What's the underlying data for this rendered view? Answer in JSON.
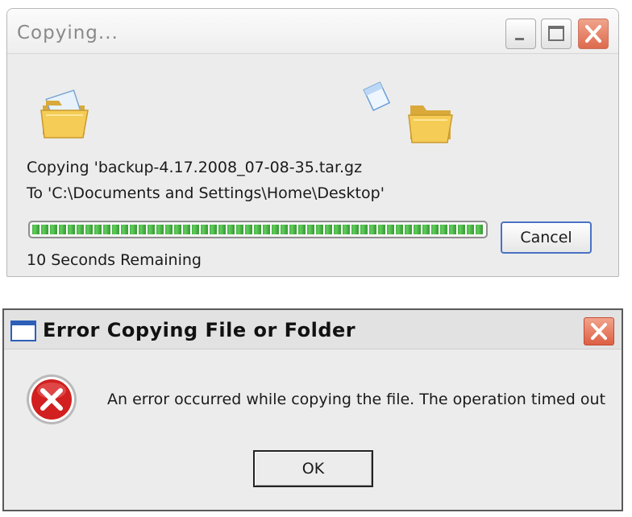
{
  "copy_dialog": {
    "title": "Copying...",
    "line1": "Copying 'backup-4.17.2008_07-08-35.tar.gz",
    "line2": "To 'C:\\Documents and Settings\\Home\\Desktop'",
    "progress_fraction": 1.0,
    "cancel_label": "Cancel",
    "remaining_text": "10 Seconds Remaining",
    "icons": {
      "source": "folder-with-document-icon",
      "flying": "document-icon",
      "destination": "folder-icon",
      "minimize": "minimize-icon",
      "maximize": "maximize-icon",
      "close": "close-icon"
    },
    "colors": {
      "progress": "#4fbf4c",
      "close": "#dd6a4d"
    }
  },
  "error_dialog": {
    "title": "Error Copying File or Folder",
    "message": "An error occurred while copying the file. The operation timed out",
    "ok_label": "OK",
    "icons": {
      "app": "window-icon",
      "error": "error-icon",
      "close": "close-icon"
    },
    "colors": {
      "error": "#d21f1f",
      "close": "#dc5f43"
    }
  }
}
